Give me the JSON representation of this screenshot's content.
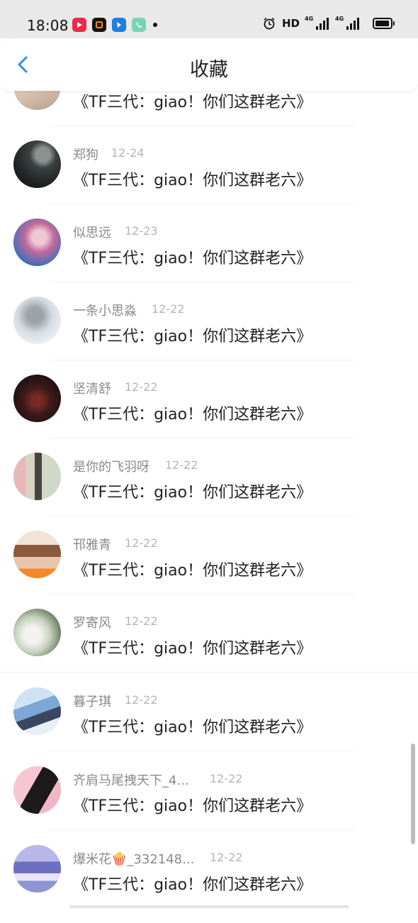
{
  "status_bar": {
    "time": "18:08",
    "hd": "HD",
    "net1": "4G",
    "net2": "4G"
  },
  "header": {
    "title": "收藏",
    "back_icon": "chevron-left-icon",
    "accent": "#2b8ff3"
  },
  "items": [
    {
      "name": "",
      "date": "",
      "text": "《TF三代：giao！你们这群老六》"
    },
    {
      "name": "郑狗",
      "date": "12-24",
      "text": "《TF三代：giao！你们这群老六》"
    },
    {
      "name": "似思远",
      "date": "12-23",
      "text": "《TF三代：giao！你们这群老六》"
    },
    {
      "name": "一条小思淼",
      "date": "12-22",
      "text": "《TF三代：giao！你们这群老六》"
    },
    {
      "name": "坚清舒",
      "date": "12-22",
      "text": "《TF三代：giao！你们这群老六》"
    },
    {
      "name": "是你的飞羽呀",
      "date": "12-22",
      "text": "《TF三代：giao！你们这群老六》"
    },
    {
      "name": "邗雅青",
      "date": "12-22",
      "text": "《TF三代：giao！你们这群老六》"
    },
    {
      "name": "罗寄风",
      "date": "12-22",
      "text": "《TF三代：giao！你们这群老六》"
    },
    {
      "name": "暮子琪",
      "date": "12-22",
      "text": "《TF三代：giao！你们这群老六》"
    },
    {
      "name": "齐肩马尾拽天下_4...",
      "date": "12-22",
      "text": "《TF三代：giao！你们这群老六》"
    },
    {
      "name": "爆米花🍿_332148...",
      "date": "12-22",
      "text": "《TF三代：giao！你们这群老六》"
    }
  ]
}
